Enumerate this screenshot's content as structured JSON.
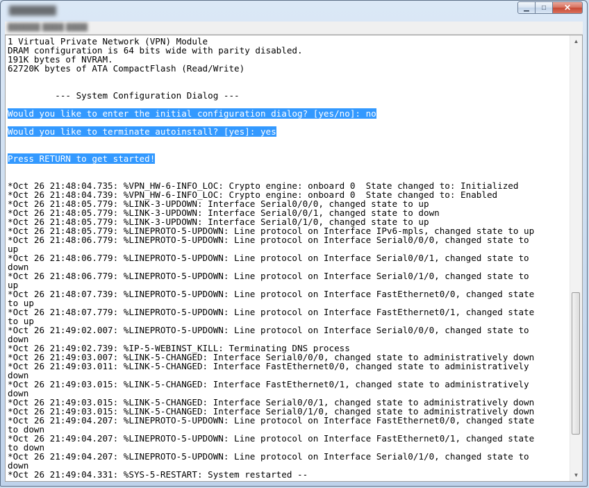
{
  "window": {
    "title": "████████",
    "menu_text": "██████ ████ ████",
    "controls": {
      "minimize": "▁",
      "maximize": "□",
      "close": "✕"
    }
  },
  "console_lines": [
    {
      "text": "1 Virtual Private Network (VPN) Module",
      "selected": false
    },
    {
      "text": "DRAM configuration is 64 bits wide with parity disabled.",
      "selected": false
    },
    {
      "text": "191K bytes of NVRAM.",
      "selected": false
    },
    {
      "text": "62720K bytes of ATA CompactFlash (Read/Write)",
      "selected": false
    },
    {
      "text": "",
      "selected": false
    },
    {
      "text": "",
      "selected": false
    },
    {
      "text": "         --- System Configuration Dialog ---",
      "selected": false
    },
    {
      "text": "",
      "selected": false
    },
    {
      "text": "Would you like to enter the initial configuration dialog? [yes/no]: no",
      "selected": true
    },
    {
      "text": "",
      "selected": false
    },
    {
      "text": "Would you like to terminate autoinstall? [yes]: yes",
      "selected": true
    },
    {
      "text": "",
      "selected": false
    },
    {
      "text": "",
      "selected": false
    },
    {
      "text": "Press RETURN to get started!",
      "selected": true
    },
    {
      "text": "",
      "selected": false
    },
    {
      "text": "",
      "selected": false
    },
    {
      "text": "*Oct 26 21:48:04.735: %VPN_HW-6-INFO_LOC: Crypto engine: onboard 0  State changed to: Initialized",
      "selected": false
    },
    {
      "text": "*Oct 26 21:48:04.739: %VPN_HW-6-INFO_LOC: Crypto engine: onboard 0  State changed to: Enabled",
      "selected": false
    },
    {
      "text": "*Oct 26 21:48:05.779: %LINK-3-UPDOWN: Interface Serial0/0/0, changed state to up",
      "selected": false
    },
    {
      "text": "*Oct 26 21:48:05.779: %LINK-3-UPDOWN: Interface Serial0/0/1, changed state to down",
      "selected": false
    },
    {
      "text": "*Oct 26 21:48:05.779: %LINK-3-UPDOWN: Interface Serial0/1/0, changed state to up",
      "selected": false
    },
    {
      "text": "*Oct 26 21:48:05.779: %LINEPROTO-5-UPDOWN: Line protocol on Interface IPv6-mpls, changed state to up",
      "selected": false
    },
    {
      "text": "*Oct 26 21:48:06.779: %LINEPROTO-5-UPDOWN: Line protocol on Interface Serial0/0/0, changed state to",
      "selected": false
    },
    {
      "text": "up",
      "selected": false
    },
    {
      "text": "*Oct 26 21:48:06.779: %LINEPROTO-5-UPDOWN: Line protocol on Interface Serial0/0/1, changed state to",
      "selected": false
    },
    {
      "text": "down",
      "selected": false
    },
    {
      "text": "*Oct 26 21:48:06.779: %LINEPROTO-5-UPDOWN: Line protocol on Interface Serial0/1/0, changed state to",
      "selected": false
    },
    {
      "text": "up",
      "selected": false
    },
    {
      "text": "*Oct 26 21:48:07.739: %LINEPROTO-5-UPDOWN: Line protocol on Interface FastEthernet0/0, changed state",
      "selected": false
    },
    {
      "text": "to up",
      "selected": false
    },
    {
      "text": "*Oct 26 21:48:07.779: %LINEPROTO-5-UPDOWN: Line protocol on Interface FastEthernet0/1, changed state",
      "selected": false
    },
    {
      "text": "to up",
      "selected": false
    },
    {
      "text": "*Oct 26 21:49:02.007: %LINEPROTO-5-UPDOWN: Line protocol on Interface Serial0/0/0, changed state to",
      "selected": false
    },
    {
      "text": "down",
      "selected": false
    },
    {
      "text": "*Oct 26 21:49:02.739: %IP-5-WEBINST_KILL: Terminating DNS process",
      "selected": false
    },
    {
      "text": "*Oct 26 21:49:03.007: %LINK-5-CHANGED: Interface Serial0/0/0, changed state to administratively down",
      "selected": false
    },
    {
      "text": "*Oct 26 21:49:03.011: %LINK-5-CHANGED: Interface FastEthernet0/0, changed state to administratively",
      "selected": false
    },
    {
      "text": "down",
      "selected": false
    },
    {
      "text": "*Oct 26 21:49:03.015: %LINK-5-CHANGED: Interface FastEthernet0/1, changed state to administratively",
      "selected": false
    },
    {
      "text": "down",
      "selected": false
    },
    {
      "text": "*Oct 26 21:49:03.015: %LINK-5-CHANGED: Interface Serial0/0/1, changed state to administratively down",
      "selected": false
    },
    {
      "text": "*Oct 26 21:49:03.015: %LINK-5-CHANGED: Interface Serial0/1/0, changed state to administratively down",
      "selected": false
    },
    {
      "text": "*Oct 26 21:49:04.207: %LINEPROTO-5-UPDOWN: Line protocol on Interface FastEthernet0/0, changed state",
      "selected": false
    },
    {
      "text": "to down",
      "selected": false
    },
    {
      "text": "*Oct 26 21:49:04.207: %LINEPROTO-5-UPDOWN: Line protocol on Interface FastEthernet0/1, changed state",
      "selected": false
    },
    {
      "text": "to down",
      "selected": false
    },
    {
      "text": "*Oct 26 21:49:04.207: %LINEPROTO-5-UPDOWN: Line protocol on Interface Serial0/1/0, changed state to",
      "selected": false
    },
    {
      "text": "down",
      "selected": false
    },
    {
      "text": "*Oct 26 21:49:04.331: %SYS-5-RESTART: System restarted --",
      "selected": false
    }
  ],
  "scrollbar": {
    "up_icon": "▲",
    "down_icon": "▼"
  },
  "colors": {
    "selection": "#3399ff",
    "selection_text": "#ffffff",
    "console_bg": "#ffffff"
  }
}
